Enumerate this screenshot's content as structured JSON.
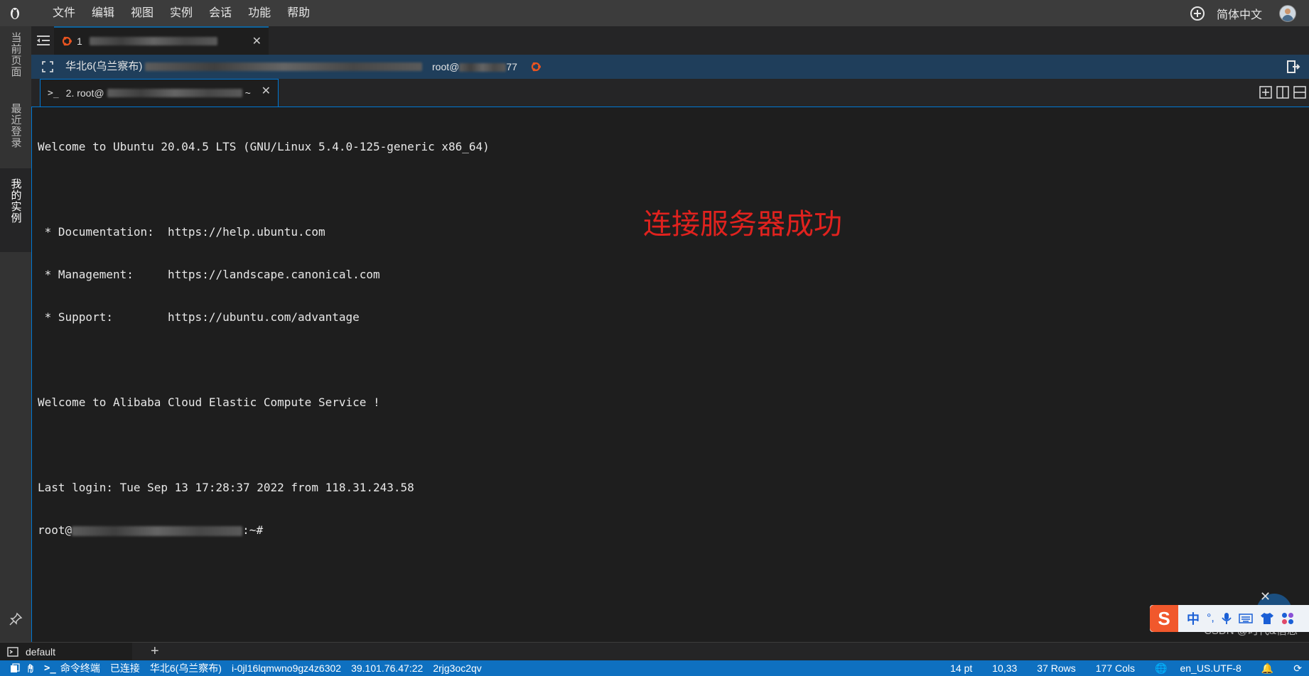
{
  "menubar": {
    "items": [
      "文件",
      "编辑",
      "视图",
      "实例",
      "会话",
      "功能",
      "帮助"
    ],
    "language": "简体中文"
  },
  "sidebar": {
    "tabs": [
      "当前页面",
      "最近登录",
      "我的实例"
    ],
    "active": "我的实例"
  },
  "session_tab": {
    "label": "1"
  },
  "server_bar": {
    "region": "华北6(乌兰察布)",
    "user": "root@",
    "suffix": "77"
  },
  "terminal_tab": {
    "label": "2. root@",
    "suffix": "~"
  },
  "terminal": {
    "lines": [
      "Welcome to Ubuntu 20.04.5 LTS (GNU/Linux 5.4.0-125-generic x86_64)",
      "",
      " * Documentation:  https://help.ubuntu.com",
      " * Management:     https://landscape.canonical.com",
      " * Support:        https://ubuntu.com/advantage",
      "",
      "Welcome to Alibaba Cloud Elastic Compute Service !",
      "",
      "Last login: Tue Sep 13 17:28:37 2022 from 118.31.243.58"
    ],
    "prompt_prefix": "root@",
    "prompt_suffix": ":~#"
  },
  "annotation": "连接服务器成功",
  "watermark": "CSDN @时代&信念",
  "ime": {
    "logo": "S",
    "mode": "中",
    "punct": "°,"
  },
  "bottom_tab": {
    "label": "default"
  },
  "status": {
    "terminal": "命令终端",
    "connection": "已连接",
    "region": "华北6(乌兰察布)",
    "instance_id": "i-0jl16lqmwno9gz4z6302",
    "ip": "39.101.76.47:22",
    "code": "2rjg3oc2qv",
    "font_size": "14 pt",
    "cursor": "10,33",
    "rows": "37 Rows",
    "cols": "177 Cols",
    "encoding": "en_US.UTF-8"
  },
  "colors": {
    "accent": "#0e70c0",
    "annotation": "#e0221e",
    "server_bar": "#1f3e5b"
  }
}
